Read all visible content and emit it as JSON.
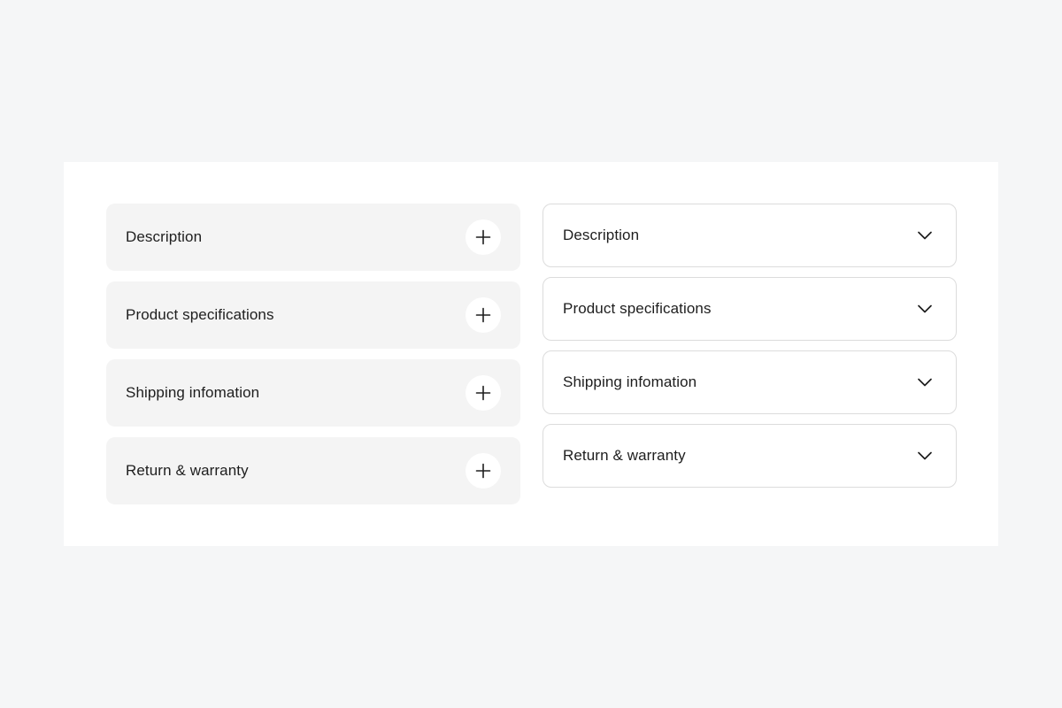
{
  "left_accordion": {
    "items": [
      {
        "label": "Description",
        "icon": "plus-icon"
      },
      {
        "label": "Product specifications",
        "icon": "plus-icon"
      },
      {
        "label": "Shipping infomation",
        "icon": "plus-icon"
      },
      {
        "label": "Return & warranty",
        "icon": "plus-icon"
      }
    ]
  },
  "right_accordion": {
    "items": [
      {
        "label": "Description",
        "icon": "chevron-down-icon"
      },
      {
        "label": "Product specifications",
        "icon": "chevron-down-icon"
      },
      {
        "label": "Shipping infomation",
        "icon": "chevron-down-icon"
      },
      {
        "label": "Return & warranty",
        "icon": "chevron-down-icon"
      }
    ]
  },
  "colors": {
    "page_background": "#f5f6f7",
    "card_background": "#ffffff",
    "filled_item_background": "#f4f4f4",
    "outline_border": "#dcdcdc",
    "text": "#1e1e1e"
  }
}
